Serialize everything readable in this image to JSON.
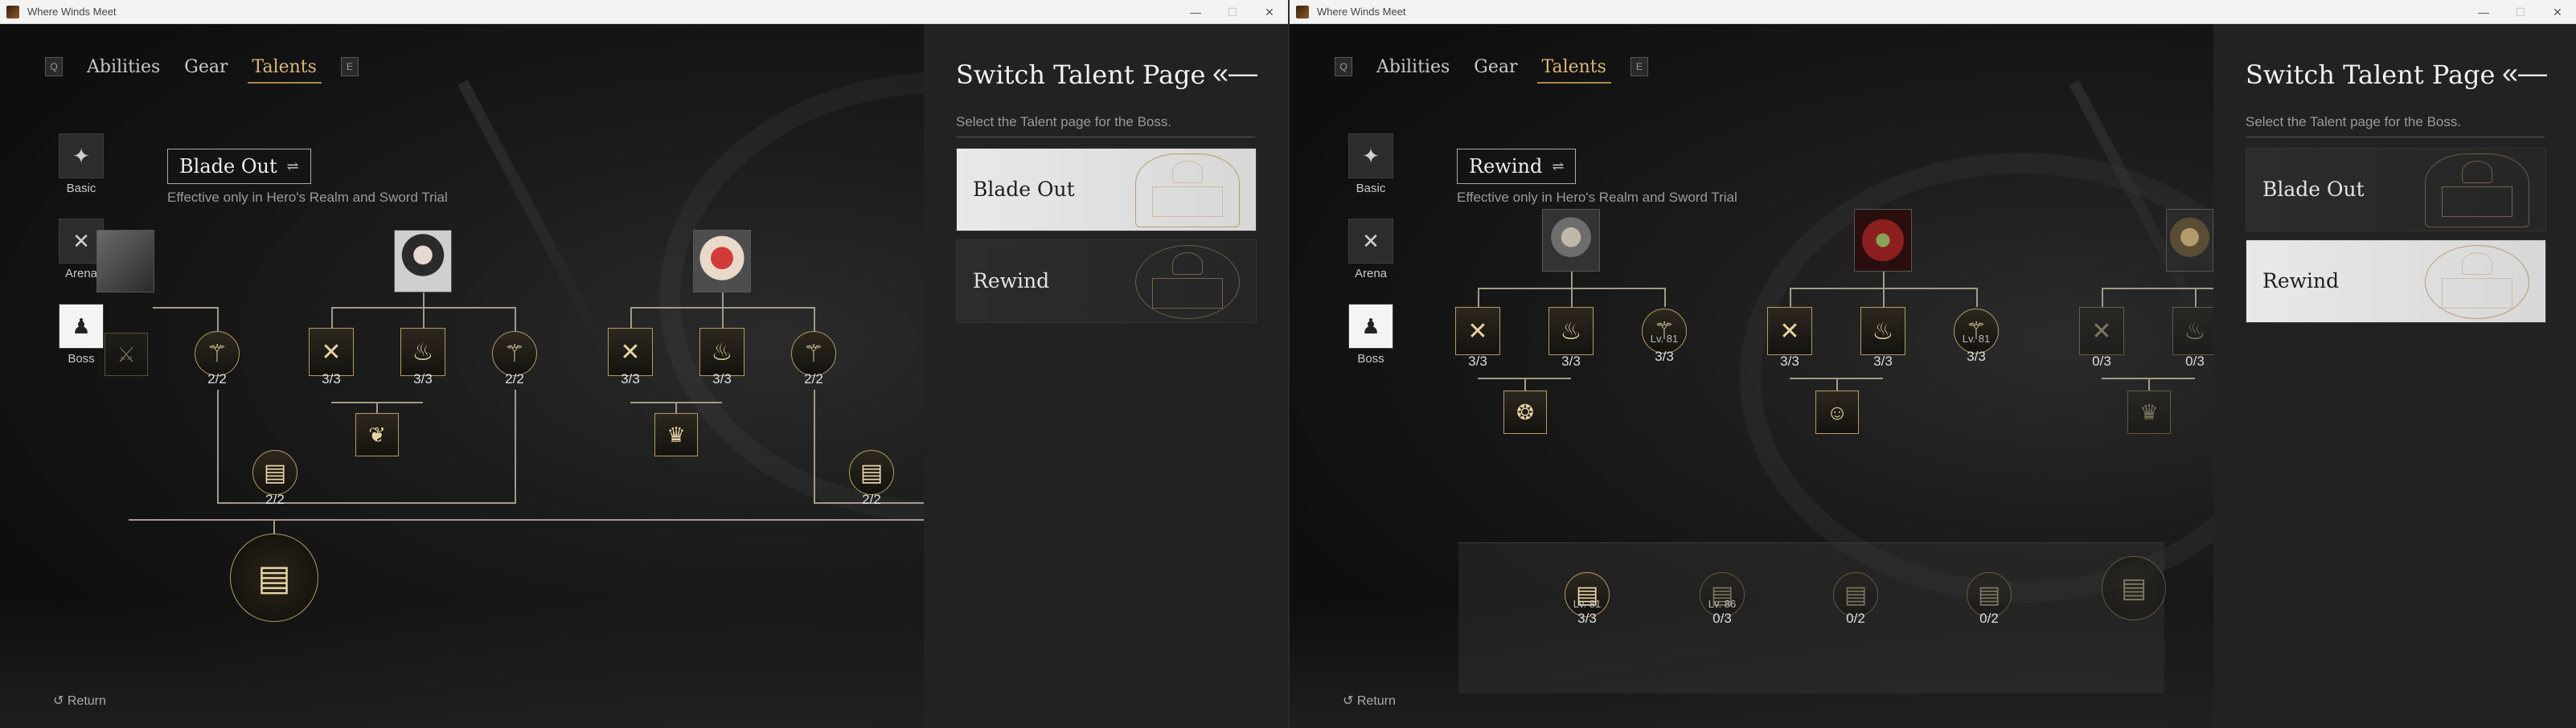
{
  "window_title": "Where Winds Meet",
  "window_controls": {
    "minimize": "—",
    "maximize": "☐",
    "close": "✕"
  },
  "nav": {
    "key_left": "Q",
    "key_right": "E",
    "tabs": [
      "Abilities",
      "Gear",
      "Talents"
    ],
    "active_tab": "Talents"
  },
  "sidebar": [
    {
      "label": "Basic",
      "icon": "bird-icon"
    },
    {
      "label": "Arena",
      "icon": "crossed-swords-icon"
    },
    {
      "label": "Boss",
      "icon": "boss-figure-icon"
    }
  ],
  "note": "Effective only in Hero's Realm and Sword Trial",
  "switch_icon": "⇌",
  "return_label": "Return",
  "panel": {
    "title": "Switch Talent Page",
    "back_icon": "«—",
    "subtitle": "Select the Talent page for the Boss.",
    "pages": [
      "Blade Out",
      "Rewind"
    ]
  },
  "left_window": {
    "current_page": "Blade Out",
    "selected_card": "Blade Out",
    "counts": {
      "c1": "2/2",
      "c2": "3/3",
      "c3": "3/3",
      "c4": "2/2",
      "c5": "3/3",
      "c6": "3/3",
      "c7": "2/2",
      "c8": "2/2",
      "c9": "2/2"
    }
  },
  "right_window": {
    "current_page": "Rewind",
    "selected_card": "Rewind",
    "counts": {
      "a1": "3/3",
      "a2": "3/3",
      "a3": "3/3",
      "b1": "3/3",
      "b2": "3/3",
      "b3": "3/3",
      "d1": "0/3",
      "d2": "0/3"
    },
    "levels": {
      "a3": "Lv. 81",
      "b3": "Lv. 81"
    },
    "bottom": [
      {
        "level": "Lv. 81",
        "count": "3/3"
      },
      {
        "level": "Lv. 86",
        "count": "0/3"
      },
      {
        "level": "",
        "count": "0/2"
      },
      {
        "level": "",
        "count": "0/2"
      }
    ]
  }
}
